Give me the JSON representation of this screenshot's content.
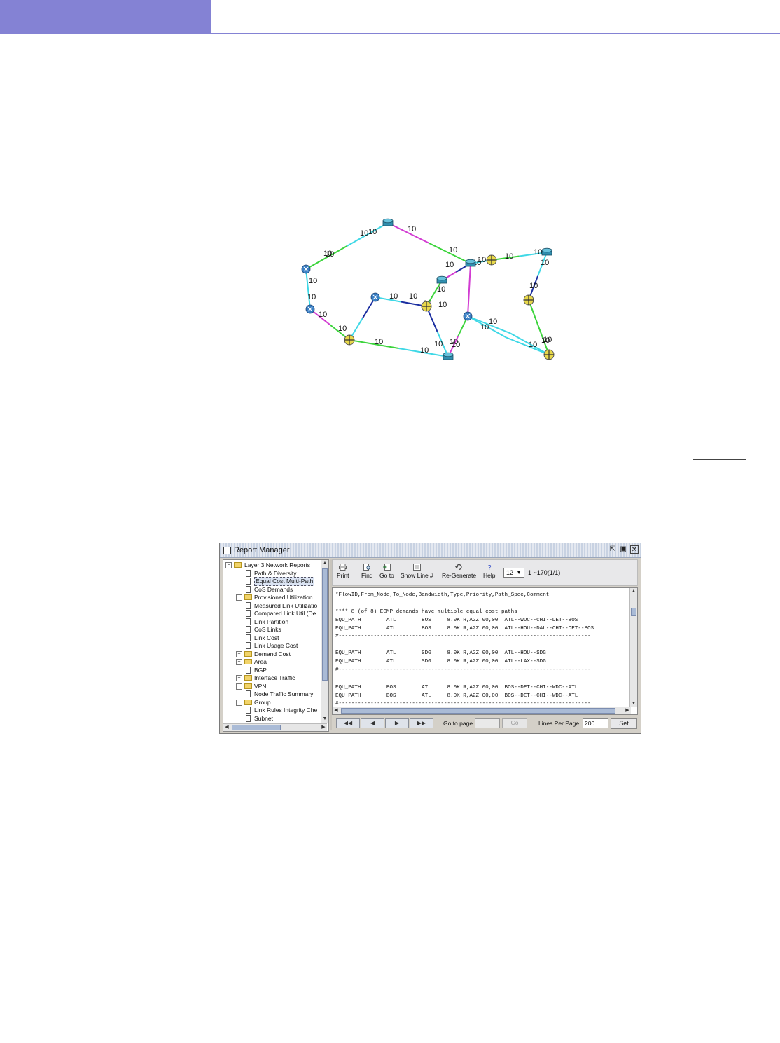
{
  "diagram": {
    "link_labels": [
      "10",
      "10",
      "10",
      "10",
      "10",
      "10",
      "10",
      "10",
      "10",
      "10",
      "10",
      "10",
      "10",
      "10",
      "10",
      "10",
      "10",
      "10",
      "10",
      "10",
      "10",
      "10",
      "10",
      "10",
      "10",
      "10",
      "10",
      "10",
      "10",
      "10",
      "10",
      "10"
    ],
    "colors": {
      "cyan": "#3fd8e6",
      "green": "#3cd43c",
      "magenta": "#d23cd2",
      "navy": "#1b2ea0",
      "router": "#2f8fb0",
      "switch": "#e8d84a"
    }
  },
  "report_manager": {
    "title": "Report Manager",
    "tree": [
      "Layer 3 Network Reports",
      "Path & Diversity",
      "Equal Cost Multi-Path",
      "CoS Demands",
      "Provisioned Utilization",
      "Measured Link Utilizatio",
      "Compared Link Util (De",
      "Link Partition",
      "CoS Links",
      "Link Cost",
      "Link Usage Cost",
      "Demand Cost",
      "Area",
      "BGP",
      "Interface Traffic",
      "VPN",
      "Node Traffic Summary",
      "Group",
      "Link Rules Integrity Che",
      "Subnet"
    ],
    "toolbar": {
      "print": "Print",
      "find": "Find",
      "goto": "Go to",
      "show_line": "Show Line #",
      "regenerate": "Re-Generate",
      "help": "Help",
      "page_size": "12",
      "range": "1 ~170(1/1)"
    },
    "report_lines": [
      "*FlowID,From_Node,To_Node,Bandwidth,Type,Priority,Path_Spec,Comment",
      "**** 8 (of 8) ECMP demands have multiple equal cost paths",
      "EQU_PATH        ATL        BOS     8.0K R,A2Z 00,00  ATL--WDC--CHI--DET--BOS",
      "EQU_PATH        ATL        BOS     8.0K R,A2Z 00,00  ATL--HOU--DAL--CHI--DET--BOS",
      "#-------------------------------------------------------------------------------",
      "EQU_PATH        ATL        SDG     8.0K R,A2Z 00,00  ATL--HOU--SDG",
      "EQU_PATH        ATL        SDG     8.0K R,A2Z 00,00  ATL--LAX--SDG",
      "#-------------------------------------------------------------------------------",
      "EQU_PATH        BOS        ATL     8.0K R,A2Z 00,00  BOS--DET--CHI--WDC--ATL",
      "EQU_PATH        BOS        ATL     8.0K R,A2Z 00,00  BOS--DET--CHI--WDC--ATL",
      "#-------------------------------------------------------------------------------"
    ],
    "pager": {
      "goto_page_label": "Go to page",
      "go_button": "Go",
      "lines_per_page_label": "Lines Per Page",
      "lines_per_page_value": "200",
      "set_button": "Set"
    }
  }
}
